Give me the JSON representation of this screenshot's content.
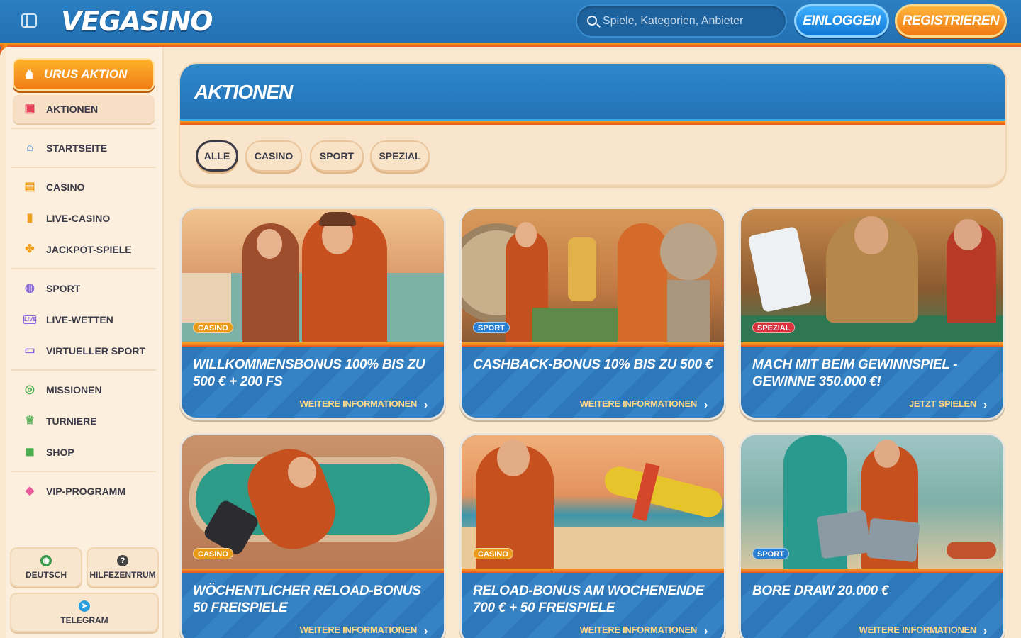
{
  "header": {
    "logo": "VEGASINO",
    "search_placeholder": "Spiele, Kategorien, Anbieter",
    "login_label": "EINLOGGEN",
    "register_label": "REGISTRIEREN"
  },
  "sidebar": {
    "promo_label": "URUS AKTION",
    "items": [
      {
        "label": "AKTIONEN",
        "icon": "gift-icon"
      },
      {
        "label": "STARTSEITE",
        "icon": "home-icon"
      },
      {
        "label": "CASINO",
        "icon": "slot-machine-icon"
      },
      {
        "label": "LIVE-CASINO",
        "icon": "card-icon"
      },
      {
        "label": "JACKPOT-SPIELE",
        "icon": "clover-icon"
      },
      {
        "label": "SPORT",
        "icon": "ball-icon"
      },
      {
        "label": "LIVE-WETTEN",
        "icon": "live-icon"
      },
      {
        "label": "VIRTUELLER SPORT",
        "icon": "virtual-icon"
      },
      {
        "label": "MISSIONEN",
        "icon": "mission-icon"
      },
      {
        "label": "TURNIERE",
        "icon": "trophy-icon"
      },
      {
        "label": "SHOP",
        "icon": "shop-icon"
      },
      {
        "label": "VIP-PROGRAMM",
        "icon": "diamond-icon"
      }
    ],
    "language_label": "DEUTSCH",
    "help_label": "HILFEZENTRUM",
    "telegram_label": "TELEGRAM"
  },
  "main": {
    "title": "AKTIONEN",
    "filters": [
      "ALLE",
      "CASINO",
      "SPORT",
      "SPEZIAL"
    ],
    "active_filter": "ALLE",
    "cards": [
      {
        "badge": "CASINO",
        "title": "WILLKOMMENSBONUS 100% BIS ZU 500 € + 200 FS",
        "link": "WEITERE INFORMATIONEN"
      },
      {
        "badge": "SPORT",
        "title": "CASHBACK-BONUS 10% BIS ZU 500 €",
        "link": "WEITERE INFORMATIONEN"
      },
      {
        "badge": "SPEZIAL",
        "title": "MACH MIT BEIM GEWINNSPIEL - GEWINNE 350.000 €!",
        "link": "JETZT SPIELEN"
      },
      {
        "badge": "CASINO",
        "title": "WÖCHENTLICHER RELOAD-BONUS 50 FREISPIELE",
        "link": "WEITERE INFORMATIONEN"
      },
      {
        "badge": "CASINO",
        "title": "RELOAD-BONUS AM WOCHENENDE 700 € + 50 FREISPIELE",
        "link": "WEITERE INFORMATIONEN"
      },
      {
        "badge": "SPORT",
        "title": "BORE DRAW 20.000 €",
        "link": "WEITERE INFORMATIONEN"
      }
    ]
  },
  "colors": {
    "header_blue": "#2b7fc2",
    "accent_orange": "#f07c14",
    "page_cream": "#fbe9cf",
    "link_gold": "#ffd889"
  }
}
